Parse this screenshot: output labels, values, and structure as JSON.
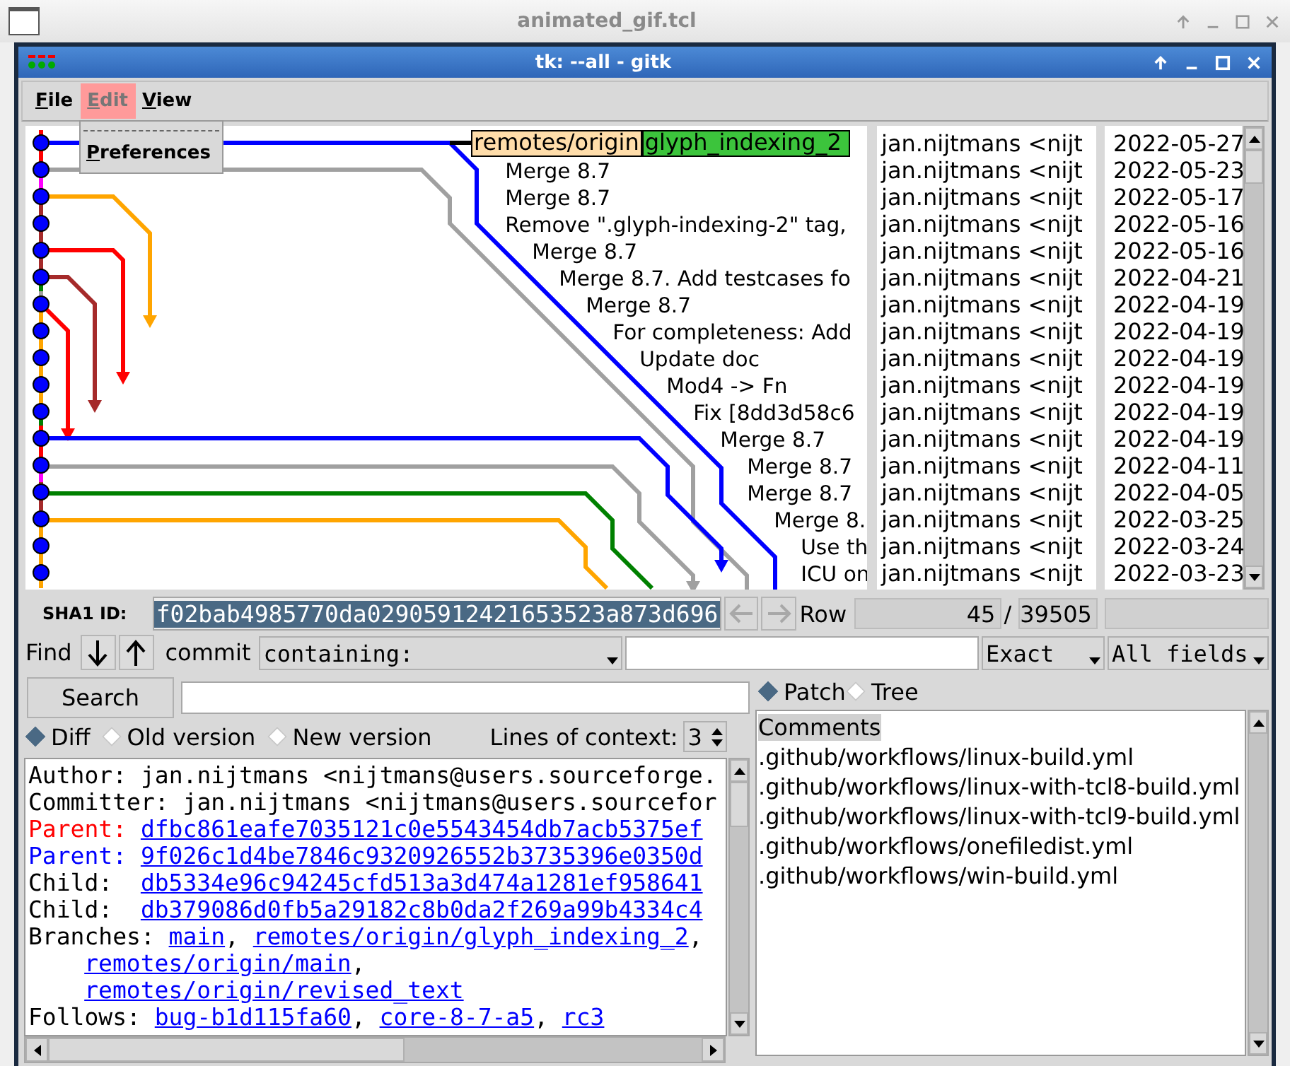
{
  "outer_window": {
    "title": "animated_gif.tcl"
  },
  "window": {
    "title": "tk: --all - gitk"
  },
  "menu": [
    {
      "label": "File",
      "selected": false
    },
    {
      "label": "Edit",
      "selected": true
    },
    {
      "label": "View",
      "selected": false
    }
  ],
  "open_menu": {
    "items": [
      "Preferences"
    ]
  },
  "commits": [
    {
      "refs": [
        {
          "text": "remotes/origin",
          "kind": "remote"
        },
        {
          "text": "glyph_indexing_2",
          "kind": "head"
        }
      ],
      "author": "jan.nijtmans <nijt",
      "date": "2022-05-27"
    },
    {
      "subject": "Merge 8.7",
      "author": "jan.nijtmans <nijt",
      "date": "2022-05-23"
    },
    {
      "subject": "Merge 8.7",
      "author": "jan.nijtmans <nijt",
      "date": "2022-05-17"
    },
    {
      "subject": "Remove \".glyph-indexing-2\" tag,",
      "author": "jan.nijtmans <nijt",
      "date": "2022-05-16"
    },
    {
      "subject": "Merge 8.7",
      "author": "jan.nijtmans <nijt",
      "date": "2022-05-16"
    },
    {
      "subject": "Merge 8.7. Add testcases fo",
      "author": "jan.nijtmans <nijt",
      "date": "2022-04-21"
    },
    {
      "subject": "Merge 8.7",
      "author": "jan.nijtmans <nijt",
      "date": "2022-04-19"
    },
    {
      "subject": "For completeness: Add",
      "author": "jan.nijtmans <nijt",
      "date": "2022-04-19"
    },
    {
      "subject": "Update doc",
      "author": "jan.nijtmans <nijt",
      "date": "2022-04-19"
    },
    {
      "subject": "Mod4 -> Fn",
      "author": "jan.nijtmans <nijt",
      "date": "2022-04-19"
    },
    {
      "subject": "Fix [8dd3d58c6",
      "author": "jan.nijtmans <nijt",
      "date": "2022-04-19"
    },
    {
      "subject": "Merge 8.7",
      "author": "jan.nijtmans <nijt",
      "date": "2022-04-19"
    },
    {
      "subject": "Merge 8.7",
      "author": "jan.nijtmans <nijt",
      "date": "2022-04-11"
    },
    {
      "subject": "Merge 8.7",
      "author": "jan.nijtmans <nijt",
      "date": "2022-04-05"
    },
    {
      "subject": "Merge 8.",
      "author": "jan.nijtmans <nijt",
      "date": "2022-03-25"
    },
    {
      "subject": "Use th",
      "author": "jan.nijtmans <nijt",
      "date": "2022-03-24"
    },
    {
      "subject": "ICU on",
      "author": "jan.nijtmans <nijt",
      "date": "2022-03-23"
    }
  ],
  "sha1": {
    "label": "SHA1 ID:",
    "value": "f02bab4985770da02905912421653523a873d696"
  },
  "row": {
    "label": "Row",
    "current": "45",
    "separator": "/",
    "total": "39505"
  },
  "find": {
    "label": "Find",
    "type_label": "commit",
    "mode": "containing:",
    "match": "Exact",
    "fields": "All fields"
  },
  "search_button": "Search",
  "view_mode": [
    {
      "label": "Patch",
      "selected": true
    },
    {
      "label": "Tree",
      "selected": false
    }
  ],
  "diff_mode": [
    {
      "label": "Diff",
      "selected": true
    },
    {
      "label": "Old version",
      "selected": false
    },
    {
      "label": "New version",
      "selected": false
    }
  ],
  "context": {
    "label": "Lines of context:",
    "value": "3"
  },
  "details": [
    {
      "continuation": false,
      "segments": [
        {
          "kind": "plain",
          "text": "Author: jan.nijtmans <nijtmans@users.sourceforge."
        }
      ]
    },
    {
      "continuation": false,
      "segments": [
        {
          "kind": "plain",
          "text": "Committer: jan.nijtmans <nijtmans@users.sourcefor"
        }
      ]
    },
    {
      "continuation": false,
      "segments": [
        {
          "kind": "plain",
          "text": "Parent:",
          "color": "#ff0000"
        },
        {
          "kind": "link",
          "text": "dfbc861eafe7035121c0e5543454db7acb5375ef"
        }
      ]
    },
    {
      "continuation": false,
      "segments": [
        {
          "kind": "plain",
          "text": "Parent:",
          "color": "#0000ff"
        },
        {
          "kind": "link",
          "text": "9f026c1d4be7846c9320926552b3735396e0350d"
        }
      ]
    },
    {
      "continuation": false,
      "segments": [
        {
          "kind": "plain",
          "text": "Child: "
        },
        {
          "kind": "link",
          "text": "db5334e96c94245cfd513a3d474a1281ef958641"
        }
      ]
    },
    {
      "continuation": false,
      "segments": [
        {
          "kind": "plain",
          "text": "Child: "
        },
        {
          "kind": "link",
          "text": "db379086d0fb5a29182c8b0da2f269a99b4334c4"
        }
      ]
    },
    {
      "continuation": false,
      "segments": [
        {
          "kind": "plain",
          "text": "Branches:"
        },
        {
          "kind": "link",
          "text": "main"
        },
        {
          "kind": "plain",
          "text": ","
        },
        {
          "kind": "link",
          "text": "remotes/origin/glyph_indexing_2"
        },
        {
          "kind": "plain",
          "text": ","
        }
      ]
    },
    {
      "continuation": true,
      "segments": [
        {
          "kind": "link",
          "text": "remotes/origin/main"
        },
        {
          "kind": "plain",
          "text": ","
        }
      ]
    },
    {
      "continuation": true,
      "segments": [
        {
          "kind": "link",
          "text": "remotes/origin/revised_text"
        }
      ]
    },
    {
      "continuation": false,
      "segments": [
        {
          "kind": "plain",
          "text": "Follows:"
        },
        {
          "kind": "link",
          "text": "bug-b1d115fa60"
        },
        {
          "kind": "plain",
          "text": ","
        },
        {
          "kind": "link",
          "text": "core-8-7-a5"
        },
        {
          "kind": "plain",
          "text": ","
        },
        {
          "kind": "link",
          "text": "rc3"
        }
      ]
    }
  ],
  "files": [
    {
      "name": "Comments",
      "selected": true
    },
    {
      "name": ".github/workflows/linux-build.yml",
      "selected": false
    },
    {
      "name": ".github/workflows/linux-with-tcl8-build.yml",
      "selected": false
    },
    {
      "name": ".github/workflows/linux-with-tcl9-build.yml",
      "selected": false
    },
    {
      "name": ".github/workflows/onefiledist.yml",
      "selected": false
    },
    {
      "name": ".github/workflows/win-build.yml",
      "selected": false
    }
  ]
}
